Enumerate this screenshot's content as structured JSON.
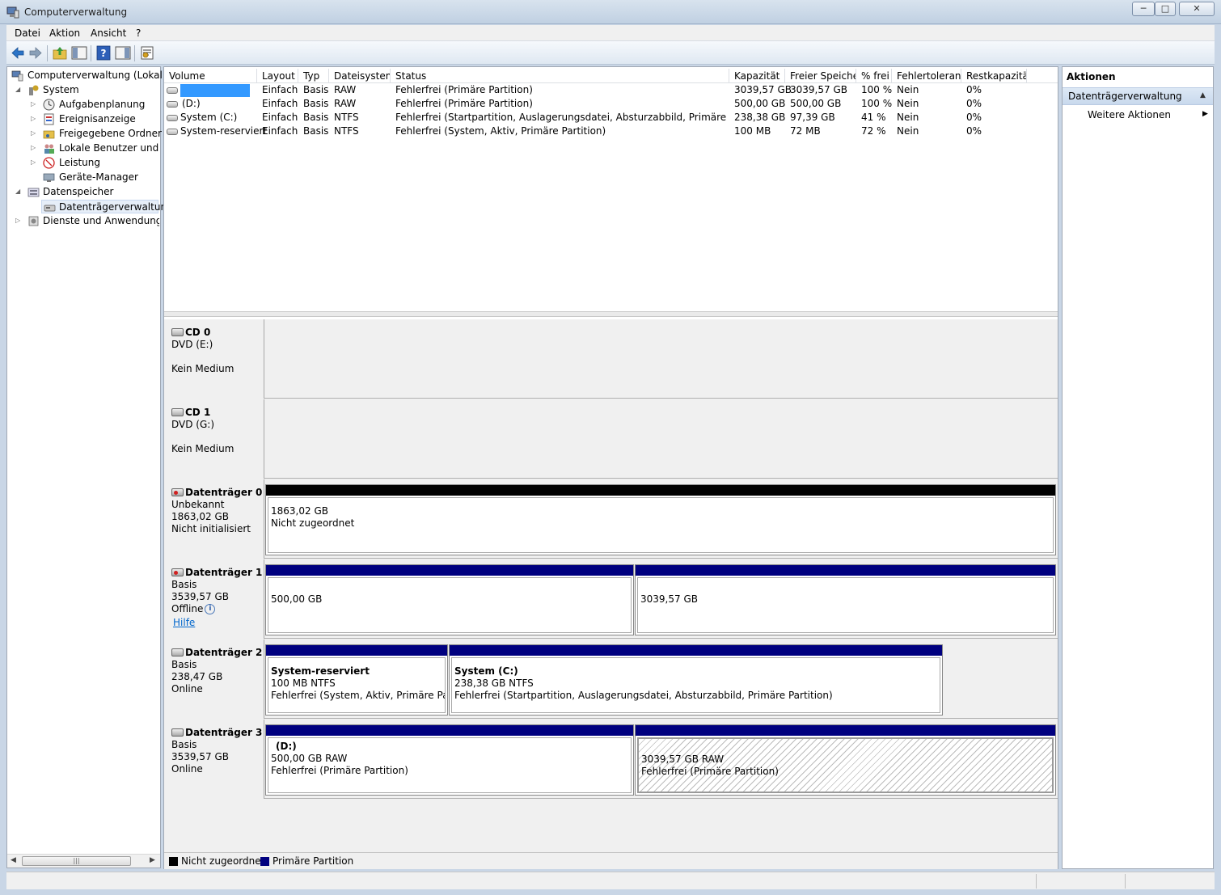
{
  "window": {
    "title": "Computerverwaltung"
  },
  "menu": [
    "Datei",
    "Aktion",
    "Ansicht",
    "?"
  ],
  "tree": {
    "root": "Computerverwaltung (Lokal)",
    "system": "System",
    "aufgaben": "Aufgabenplanung",
    "ereignis": "Ereignisanzeige",
    "freigabe": "Freigegebene Ordner",
    "lokale": "Lokale Benutzer und Gr",
    "leistung": "Leistung",
    "geraete": "Geräte-Manager",
    "datenspeicher": "Datenspeicher",
    "datentraeger": "Datenträgerverwaltung",
    "dienste": "Dienste und Anwendungen"
  },
  "columns": [
    "Volume",
    "Layout",
    "Typ",
    "Dateisystem",
    "Status",
    "Kapazität",
    "Freier Speicher",
    "% frei",
    "Fehlertoleranz",
    "Restkapazität"
  ],
  "volumes": [
    {
      "name": "",
      "layout": "Einfach",
      "typ": "Basis",
      "fs": "RAW",
      "status": "Fehlerfrei (Primäre Partition)",
      "kap": "3039,57 GB",
      "frei": "3039,57 GB",
      "pct": "100 %",
      "fehler": "Nein",
      "rest": "0%"
    },
    {
      "name": "(D:)",
      "layout": "Einfach",
      "typ": "Basis",
      "fs": "RAW",
      "status": "Fehlerfrei (Primäre Partition)",
      "kap": "500,00 GB",
      "frei": "500,00 GB",
      "pct": "100 %",
      "fehler": "Nein",
      "rest": "0%"
    },
    {
      "name": "System (C:)",
      "layout": "Einfach",
      "typ": "Basis",
      "fs": "NTFS",
      "status": "Fehlerfrei (Startpartition, Auslagerungsdatei, Absturzabbild, Primäre Partition)",
      "kap": "238,38 GB",
      "frei": "97,39 GB",
      "pct": "41 %",
      "fehler": "Nein",
      "rest": "0%"
    },
    {
      "name": "System-reserviert",
      "layout": "Einfach",
      "typ": "Basis",
      "fs": "NTFS",
      "status": "Fehlerfrei (System, Aktiv, Primäre Partition)",
      "kap": "100 MB",
      "frei": "72 MB",
      "pct": "72 %",
      "fehler": "Nein",
      "rest": "0%"
    }
  ],
  "disks": {
    "cd0": {
      "name": "CD 0",
      "line1": "DVD (E:)",
      "line3": "Kein Medium"
    },
    "cd1": {
      "name": "CD 1",
      "line1": "DVD (G:)",
      "line3": "Kein Medium"
    },
    "d0": {
      "name": "Datenträger 0",
      "l1": "Unbekannt",
      "l2": "1863,02 GB",
      "l3": "Nicht initialisiert",
      "p1a": "1863,02 GB",
      "p1b": "Nicht zugeordnet"
    },
    "d1": {
      "name": "Datenträger 1",
      "l1": "Basis",
      "l2": "3539,57 GB",
      "l3": "Offline",
      "link": "Hilfe",
      "p1": "500,00 GB",
      "p2": "3039,57 GB"
    },
    "d2": {
      "name": "Datenträger 2",
      "l1": "Basis",
      "l2": "238,47 GB",
      "l3": "Online",
      "p1a": "System-reserviert",
      "p1b": "100 MB NTFS",
      "p1c": "Fehlerfrei (System, Aktiv, Primäre Partitic",
      "p2a": "System  (C:)",
      "p2b": "238,38 GB NTFS",
      "p2c": "Fehlerfrei (Startpartition, Auslagerungsdatei, Absturzabbild, Primäre Partition)"
    },
    "d3": {
      "name": "Datenträger 3",
      "l1": "Basis",
      "l2": "3539,57 GB",
      "l3": "Online",
      "p1a": "(D:)",
      "p1b": "500,00 GB RAW",
      "p1c": "Fehlerfrei (Primäre Partition)",
      "p2b": "3039,57 GB RAW",
      "p2c": "Fehlerfrei (Primäre Partition)"
    }
  },
  "legend": {
    "unalloc": "Nicht zugeordnet",
    "primary": "Primäre Partition"
  },
  "actions": {
    "title": "Aktionen",
    "section": "Datenträgerverwaltung",
    "more": "Weitere Aktionen"
  },
  "colors": {
    "primary": "#00007f",
    "unallocated": "#000000",
    "selection": "#3399ff"
  }
}
